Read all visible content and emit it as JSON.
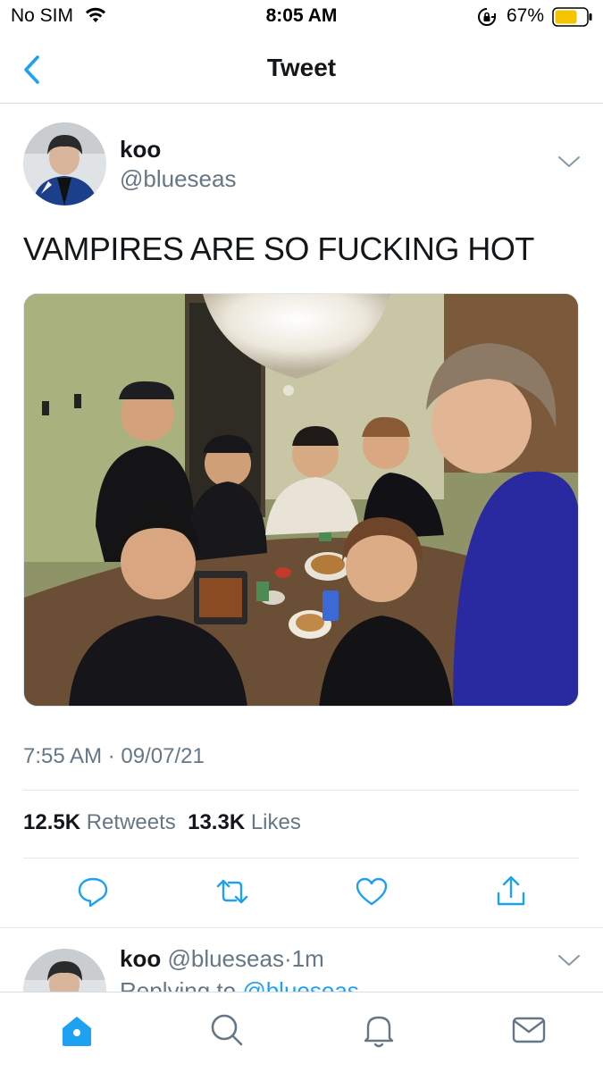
{
  "status_bar": {
    "carrier": "No SIM",
    "time": "8:05 AM",
    "battery": "67%",
    "icons": [
      "wifi-icon",
      "orientation-lock-icon",
      "battery-icon"
    ]
  },
  "nav": {
    "title": "Tweet",
    "back_icon": "chevron-left-icon"
  },
  "tweet": {
    "name": "koo",
    "handle": "@blueseas",
    "text": "VAMPIRES ARE SO FUCKING HOT",
    "timestamp": "7:55 AM · 09/07/21",
    "retweets_count": "12.5K",
    "retweets_label": "Retweets",
    "likes_count": "13.3K",
    "likes_label": "Likes",
    "actions": [
      "reply-icon",
      "retweet-icon",
      "like-icon",
      "share-icon"
    ]
  },
  "reply": {
    "name": "koo",
    "handle": "@blueseas",
    "sep": "·",
    "age": "1m",
    "replying_label": "Replying to",
    "replying_handle": "@blueseas"
  },
  "tabs": [
    "home-icon",
    "search-icon",
    "notifications-icon",
    "messages-icon"
  ],
  "colors": {
    "accent": "#1da1f2",
    "text_primary": "#14171a",
    "text_secondary": "#657786",
    "battery_fill": "#f5c400"
  }
}
